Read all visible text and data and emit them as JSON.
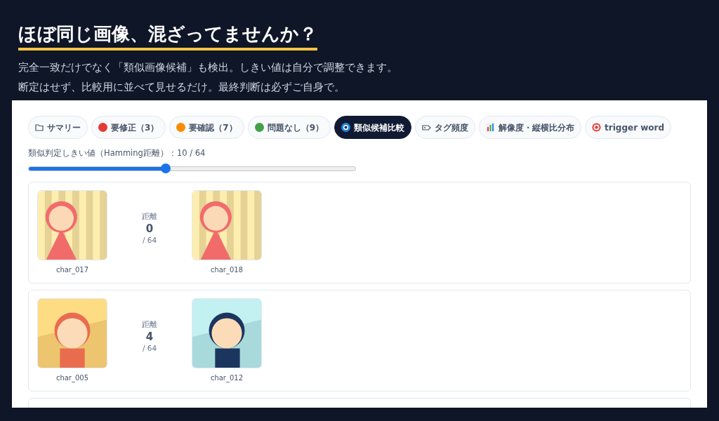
{
  "header": {
    "title": "ほぼ同じ画像、混ざってませんか？",
    "lines": [
      "完全一致だけでなく「類似画像候補」も検出。しきい値は自分で調整できます。",
      "断定はせず、比較用に並べて見せるだけ。最終判断は必ずご自身で。"
    ]
  },
  "tabs": [
    {
      "label": "サマリー",
      "kind": "folder",
      "selected": false
    },
    {
      "label": "要修正（3）",
      "kind": "dot",
      "color": "#e53935",
      "selected": false
    },
    {
      "label": "要確認（7）",
      "kind": "dot",
      "color": "#fb8c00",
      "selected": false
    },
    {
      "label": "問題なし（9）",
      "kind": "dot",
      "color": "#43a047",
      "selected": false
    },
    {
      "label": "類似候補比較",
      "kind": "eye",
      "selected": true
    },
    {
      "label": "タグ頻度",
      "kind": "tag",
      "selected": false
    },
    {
      "label": "解像度・縦横比分布",
      "kind": "chart",
      "selected": false
    },
    {
      "label": "trigger word",
      "kind": "target",
      "selected": false
    }
  ],
  "threshold": {
    "label": "類似判定しきい値（Hamming距離）：10 / 64",
    "level": 0.42
  },
  "pairs": [
    {
      "left": "char_017",
      "right": "char_018",
      "distance_label": "距離",
      "distance": "0",
      "max": "/ 64"
    },
    {
      "left": "char_005",
      "right": "char_012",
      "distance_label": "距離",
      "distance": "4",
      "max": "/ 64"
    }
  ]
}
